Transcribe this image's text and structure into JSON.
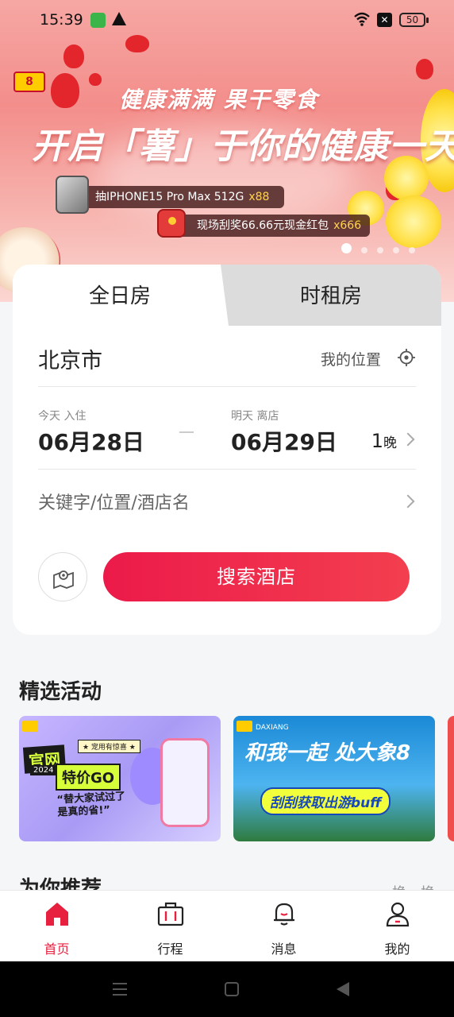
{
  "status_bar": {
    "time": "15:39",
    "battery": "50"
  },
  "banner": {
    "brand_logo": "8",
    "slogan": "健康满满 果干零食",
    "headline": "开启「薯」于你的健康一天",
    "prizes": [
      {
        "text": "抽IPHONE15 Pro Max 512G",
        "count": "x88"
      },
      {
        "text": "现场刮奖66.66元现金红包",
        "count": "x666"
      }
    ],
    "page_indicator": {
      "current": 1,
      "total": 5
    }
  },
  "search_card": {
    "tabs": [
      {
        "label": "全日房"
      },
      {
        "label": "时租房"
      }
    ],
    "city": "北京市",
    "my_location": "我的位置",
    "checkin_label": "今天 入住",
    "checkin_date": "06月28日",
    "checkout_label": "明天 离店",
    "checkout_date": "06月29日",
    "nights_num": "1",
    "nights_unit": "晚",
    "keyword_placeholder": "关键字/位置/酒店名",
    "search_button": "搜索酒店"
  },
  "activities": {
    "title": "精选活动",
    "cards": [
      {
        "line1": "官网",
        "year": "2024",
        "line2": "特价GO",
        "tag": "★ 宠用有惊喜 ★",
        "quote": "“替大家试过了 是真的省!”"
      },
      {
        "brand": "DAXIANG",
        "script": "和我一起 处大象8",
        "pill": "刮刮获取出游buff"
      }
    ]
  },
  "recommend": {
    "title": "为你推荐",
    "more": "换一换"
  },
  "tabbar": {
    "items": [
      {
        "label": "首页",
        "active": true
      },
      {
        "label": "行程",
        "active": false
      },
      {
        "label": "消息",
        "active": false
      },
      {
        "label": "我的",
        "active": false
      }
    ]
  },
  "colors": {
    "accent": "#e8203f",
    "search_gradient_start": "#ec1a4a",
    "search_gradient_end": "#f33f4f"
  }
}
